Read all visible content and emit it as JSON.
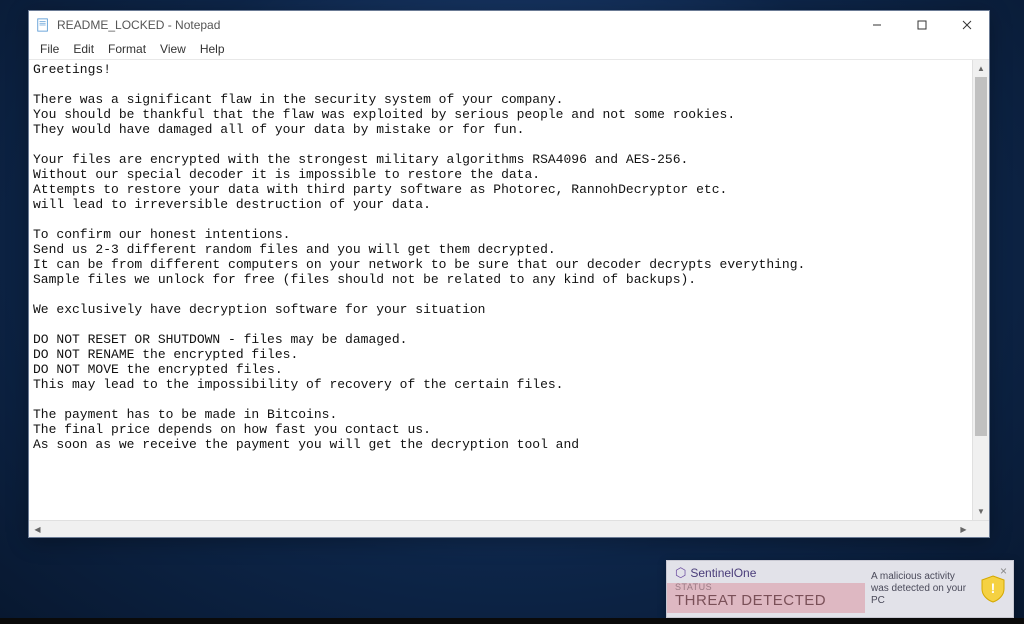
{
  "notepad": {
    "title": "README_LOCKED - Notepad",
    "menu": {
      "file": "File",
      "edit": "Edit",
      "format": "Format",
      "view": "View",
      "help": "Help"
    },
    "content": "Greetings!\n\nThere was a significant flaw in the security system of your company.\nYou should be thankful that the flaw was exploited by serious people and not some rookies.\nThey would have damaged all of your data by mistake or for fun.\n\nYour files are encrypted with the strongest military algorithms RSA4096 and AES-256.\nWithout our special decoder it is impossible to restore the data.\nAttempts to restore your data with third party software as Photorec, RannohDecryptor etc.\nwill lead to irreversible destruction of your data.\n\nTo confirm our honest intentions.\nSend us 2-3 different random files and you will get them decrypted.\nIt can be from different computers on your network to be sure that our decoder decrypts everything.\nSample files we unlock for free (files should not be related to any kind of backups).\n\nWe exclusively have decryption software for your situation\n\nDO NOT RESET OR SHUTDOWN - files may be damaged.\nDO NOT RENAME the encrypted files.\nDO NOT MOVE the encrypted files.\nThis may lead to the impossibility of recovery of the certain files.\n\nThe payment has to be made in Bitcoins.\nThe final price depends on how fast you contact us.\nAs soon as we receive the payment you will get the decryption tool and"
  },
  "toast": {
    "brand": "SentinelOne",
    "status_label": "STATUS",
    "status_value": "THREAT DETECTED",
    "message": "A malicious activity was detected on your PC"
  }
}
